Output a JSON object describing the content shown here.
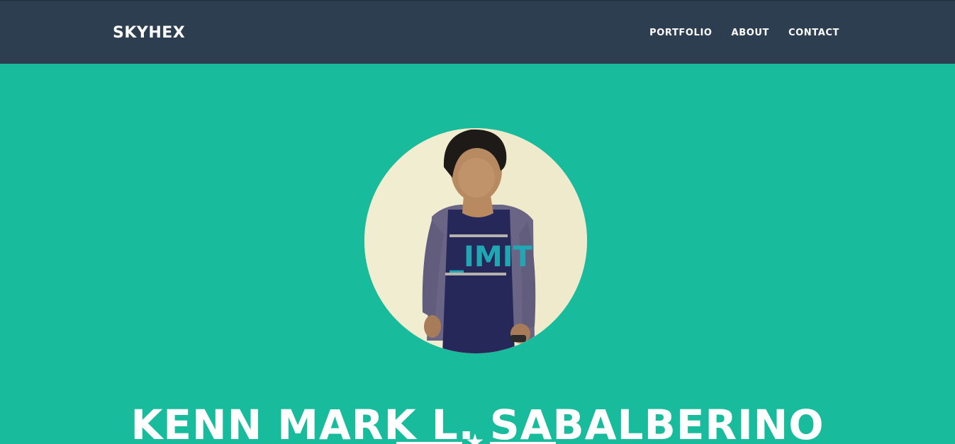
{
  "navbar": {
    "brand": "SKYHEX",
    "items": [
      {
        "label": "PORTFOLIO"
      },
      {
        "label": "ABOUT"
      },
      {
        "label": "CONTACT"
      }
    ]
  },
  "hero": {
    "avatar_icon": "profile-photo",
    "name": "KENN MARK L. SABALBERINO",
    "divider_icon": "star-icon",
    "divider_glyph": "★"
  },
  "colors": {
    "navbar_bg": "#2c3e50",
    "hero_bg": "#18bc9c",
    "text": "#ffffff"
  }
}
